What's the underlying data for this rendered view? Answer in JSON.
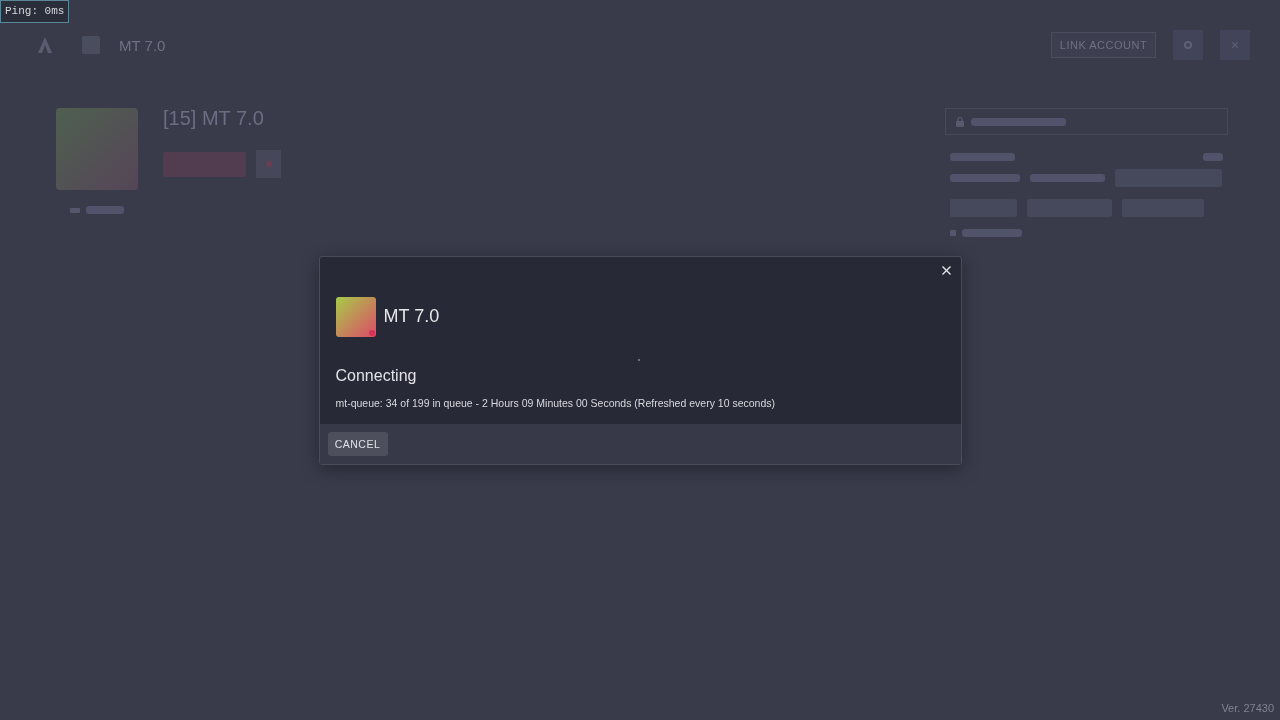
{
  "ping": {
    "label": "Ping: 0ms"
  },
  "header": {
    "title": "MT 7.0",
    "link_account_button": "LINK ACCOUNT"
  },
  "server": {
    "name": "[15] MT 7.0"
  },
  "dialog": {
    "title": "MT 7.0",
    "status": "Connecting",
    "queue_message": "mt-queue: 34 of 199 in queue - 2 Hours 09 Minutes 00 Seconds (Refreshed every 10 seconds)",
    "buttons": [
      "CANCEL"
    ]
  },
  "version": "Ver. 27430"
}
